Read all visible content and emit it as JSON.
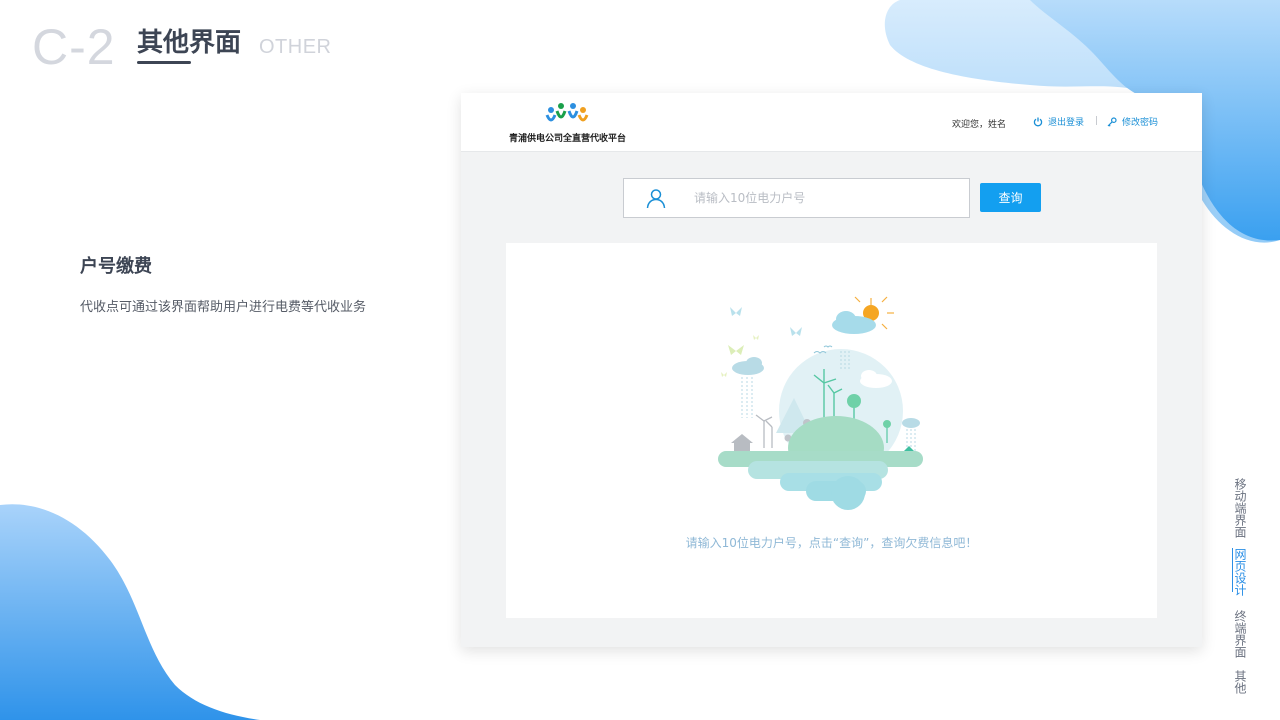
{
  "slide": {
    "section_number": "C-2",
    "section_title": "其他界面",
    "section_subtitle": "OTHER"
  },
  "description": {
    "title": "户号缴费",
    "text": "代收点可通过该界面帮助用户进行电费等代收业务"
  },
  "side_nav": {
    "items": [
      {
        "label": "移动端界面",
        "active": false
      },
      {
        "label": "网页设计",
        "active": true
      },
      {
        "label": "终端界面",
        "active": false
      },
      {
        "label": "其他",
        "active": false
      }
    ]
  },
  "app": {
    "brand": "青浦供电公司全直营代收平台",
    "welcome": "欢迎您，姓名",
    "logout_label": "退出登录",
    "separator": "|",
    "change_password_label": "修改密码",
    "search": {
      "value": "",
      "placeholder": "请输入10位电力户号"
    },
    "query_label": "查询",
    "hint": "请输入10位电力户号，点击“查询”，查询欠费信息吧！"
  },
  "icons": {
    "logo": "people-logo-icon",
    "logout": "power-icon",
    "change_password": "key-icon",
    "search": "user-icon",
    "illustration": "eco-city-illustration"
  },
  "colors": {
    "accent": "#139ff0",
    "link": "#1a8fd6",
    "heading": "#3d4554",
    "blob": "#5bb4f5"
  }
}
